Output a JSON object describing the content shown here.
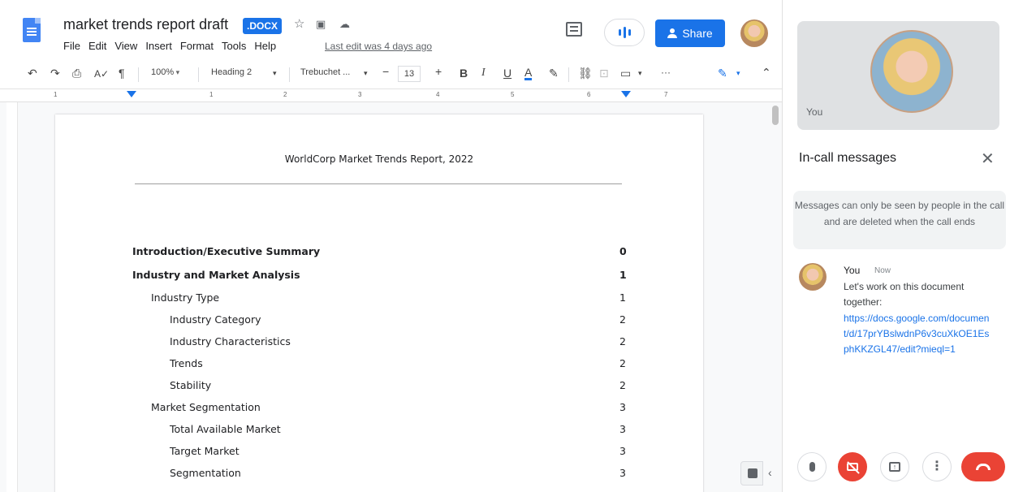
{
  "docs": {
    "title": "market trends report draft",
    "badge": ".DOCX",
    "menu": [
      "File",
      "Edit",
      "View",
      "Insert",
      "Format",
      "Tools",
      "Help"
    ],
    "last_edit": "Last edit was 4 days ago",
    "share_label": "Share",
    "toolbar": {
      "zoom": "100%",
      "style": "Heading 2",
      "font": "Trebuchet ...",
      "font_size": "13",
      "more": "···"
    },
    "ruler_numbers": [
      "1",
      "1",
      "2",
      "3",
      "4",
      "5",
      "6",
      "7"
    ]
  },
  "document": {
    "heading": "WorldCorp Market Trends Report, 2022",
    "toc": [
      {
        "label": "Introduction/Executive Summary",
        "page": "0",
        "level": 0,
        "bold": true
      },
      {
        "label": "Industry and Market Analysis",
        "page": "1",
        "level": 0,
        "bold": true
      },
      {
        "label": "Industry Type",
        "page": "1",
        "level": 1,
        "bold": false
      },
      {
        "label": "Industry Category",
        "page": "2",
        "level": 2,
        "bold": false
      },
      {
        "label": "Industry Characteristics",
        "page": "2",
        "level": 2,
        "bold": false
      },
      {
        "label": "Trends",
        "page": "2",
        "level": 2,
        "bold": false
      },
      {
        "label": "Stability",
        "page": "2",
        "level": 2,
        "bold": false
      },
      {
        "label": "Market Segmentation",
        "page": "3",
        "level": 1,
        "bold": false
      },
      {
        "label": "Total Available Market",
        "page": "3",
        "level": 2,
        "bold": false
      },
      {
        "label": "Target Market",
        "page": "3",
        "level": 2,
        "bold": false
      },
      {
        "label": "Segmentation",
        "page": "3",
        "level": 2,
        "bold": false
      }
    ]
  },
  "meet": {
    "self_label": "You",
    "panel_title": "In-call messages",
    "notice": "Messages can only be seen by people in the call and are deleted when the call ends",
    "message": {
      "sender": "You",
      "time": "Now",
      "text": "Let's work on this document together:",
      "link": "https://docs.google.com/document/d/17prYBslwdnP6v3cuXkOE1EsphKKZGL47/edit?mieql=1"
    }
  },
  "colors": {
    "accent": "#1a73e8",
    "danger": "#ea4335"
  }
}
